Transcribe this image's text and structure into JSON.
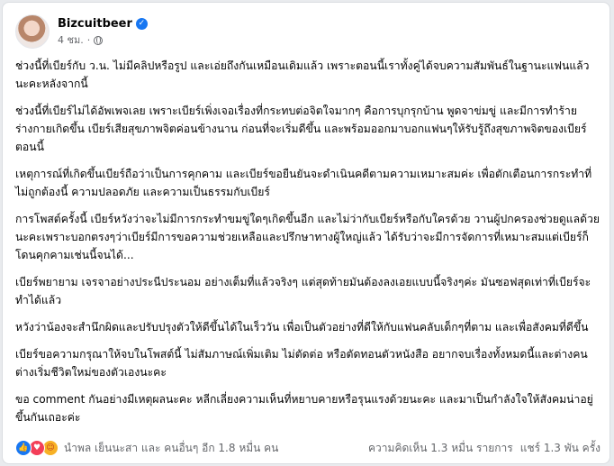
{
  "post": {
    "author": "Bizcuitbeer",
    "time": "4 ชม.",
    "separator": "·",
    "paragraphs": [
      "ช่วงนี้ที่เบียร์กับ ว.น. ไม่มีคลิปหรือรูป และเอ่ยถึงกันเหมือนเดิมแล้ว เพราะตอนนี้เราทั้งคู่ได้จบความสัมพันธ์ในฐานะแฟนแล้วนะคะหลังจากนี้",
      "ช่วงนี้ที่เบียร์ไม่ได้อัพเพจเลย เพราะเบียร์เพิ่งเจอเรื่องที่กระทบต่อจิตใจมากๆ คือการบุกรุกบ้าน พูดจาข่มขู่ และมีการทำร้ายร่างกายเกิดขึ้น เบียร์เสียสุขภาพจิตค่อนข้างนาน ก่อนที่จะเริ่มดีขึ้น และพร้อมออกมาบอกแฟนๆให้รับรู้ถึงสุขภาพจิตของเบียร์ตอนนี้",
      "เหตุการณ์ที่เกิดขึ้นเบียร์ถือว่าเป็นการคุกคาม และเบียร์ขอยืนยันจะดำเนินคดีตามความเหมาะสมค่ะ เพื่อตักเตือนการกระทำที่ไม่ถูกต้องนี้ ความปลอดภัย และความเป็นธรรมกับเบียร์",
      "การโพสต์ครั้งนี้ เบียร์หวังว่าจะไม่มีการกระทำขมขู่ใดๆเกิดขึ้นอีก และไม่ว่ากับเบียร์หรือกับใครด้วย วานผู้ปกครองช่วยดูแลด้วยนะคะเพราะบอกตรงๆว่าเบียร์มีการขอความช่วยเหลือและปรึกษาทางผู้ใหญ่แล้ว ได้รับว่าจะมีการจัดการที่เหมาะสมแต่เบียร์ก็โดนคุกคามเช่นนี้จนได้...",
      "เบียร์พยายาม เจรจาอย่างประนีประนอม อย่างเต็มที่แล้วจริงๆ แต่สุดท้ายมันต้องลงเอยแบบนี้จริงๆค่ะ มันซอฟสุดเท่าที่เบียร์จะทำได้แล้ว",
      "หวังว่าน้องจะสำนึกผิดและปรับปรุงตัวให้ดีขึ้นได้ในเร็ววัน เพื่อเป็นตัวอย่างที่ดีให้กับแฟนคลับเด็กๆที่ตาม และเพื่อสังคมที่ดีขึ้น",
      "เบียร์ขอความกรุณาให้จบในโพสต์นี้ ไม่สัมภาษณ์เพิ่มเติม ไม่ตัดต่อ หรือตัดทอนตัวหนังสือ อยากจบเรื่องทั้งหมดนี้และต่างคนต่างเริ่มชีวิตใหม่ของตัวเองนะคะ",
      "ขอ comment กันอย่างมีเหตุผลนะคะ หลีกเลี่ยงความเห็นที่หยาบคายหรือรุนแรงด้วยนะคะ และมาเป็นกำลังใจให้สังคมน่าอยู่ขึ้นกันเถอะค่ะ"
    ]
  },
  "footer": {
    "reactions_text": "นำพล เย็นนะสา และ คนอื่นๆ อีก 1.8 หมื่น คน",
    "comments": "ความคิดเห็น 1.3 หมื่น รายการ",
    "shares": "แชร์ 1.3 พัน ครั้ง",
    "reaction_icons": [
      "like-icon",
      "love-icon",
      "care-icon"
    ]
  },
  "colors": {
    "accent": "#1877f2",
    "love": "#f33e58",
    "care": "#f7b125",
    "secondary_text": "#65676b"
  }
}
